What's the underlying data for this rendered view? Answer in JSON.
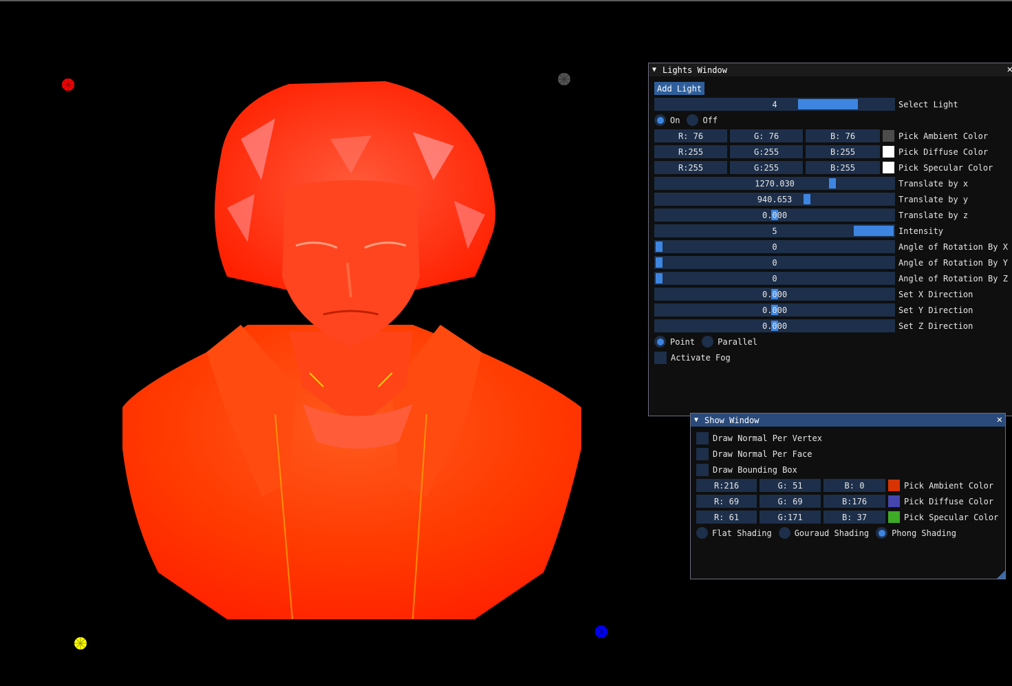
{
  "lights_window": {
    "title": "Lights Window",
    "add_light_label": "Add Light",
    "select_light": {
      "value": "4",
      "label": "Select Light",
      "fraction": 0.8
    },
    "on_label": "On",
    "off_label": "Off",
    "on_selected": true,
    "ambient": {
      "r": "R: 76",
      "g": "G: 76",
      "b": "B: 76",
      "label": "Pick Ambient Color",
      "swatch": "#4c4c4c"
    },
    "diffuse": {
      "r": "R:255",
      "g": "G:255",
      "b": "B:255",
      "label": "Pick Diffuse Color",
      "swatch": "#ffffff"
    },
    "specular": {
      "r": "R:255",
      "g": "G:255",
      "b": "B:255",
      "label": "Pick Specular Color",
      "swatch": "#ffffff"
    },
    "translate_x": {
      "value": "1270.030",
      "label": "Translate by x",
      "fraction": 0.75
    },
    "translate_y": {
      "value": "940.653",
      "label": "Translate by y",
      "fraction": 0.64
    },
    "translate_z": {
      "value": "0.000",
      "label": "Translate by z",
      "fraction": 0.5
    },
    "intensity": {
      "value": "5",
      "label": "Intensity",
      "fraction": 1.0
    },
    "rot_x": {
      "value": "0",
      "label": "Angle of Rotation By X",
      "fraction": 0.0
    },
    "rot_y": {
      "value": "0",
      "label": "Angle of Rotation By Y",
      "fraction": 0.0
    },
    "rot_z": {
      "value": "0",
      "label": "Angle of Rotation By Z",
      "fraction": 0.0
    },
    "dir_x": {
      "value": "0.000",
      "label": "Set X Direction",
      "fraction": 0.5
    },
    "dir_y": {
      "value": "0.000",
      "label": "Set Y Direction",
      "fraction": 0.5
    },
    "dir_z": {
      "value": "0.000",
      "label": "Set Z Direction",
      "fraction": 0.5
    },
    "point_label": "Point",
    "parallel_label": "Parallel",
    "point_selected": true,
    "fog_label": "Activate Fog"
  },
  "show_window": {
    "title": "Show Window",
    "close": "✕",
    "normal_vertex_label": "Draw Normal Per Vertex",
    "normal_face_label": "Draw Normal Per Face",
    "bbox_label": "Draw Bounding Box",
    "ambient": {
      "r": "R:216",
      "g": "G: 51",
      "b": "B:  0",
      "label": "Pick Ambient Color",
      "swatch": "#d83300"
    },
    "diffuse": {
      "r": "R: 69",
      "g": "G: 69",
      "b": "B:176",
      "label": "Pick Diffuse Color",
      "swatch": "#4545b0"
    },
    "specular": {
      "r": "R: 61",
      "g": "G:171",
      "b": "B: 37",
      "label": "Pick Specular Color",
      "swatch": "#3dab25"
    },
    "flat_label": "Flat Shading",
    "gouraud_label": "Gouraud Shading",
    "phong_label": "Phong Shading",
    "selected_shading": "phong"
  },
  "scene": {
    "light_colors": [
      "#ff0000",
      "#555555",
      "#ffff00",
      "#0000ff"
    ],
    "model": "beethoven-bust"
  }
}
